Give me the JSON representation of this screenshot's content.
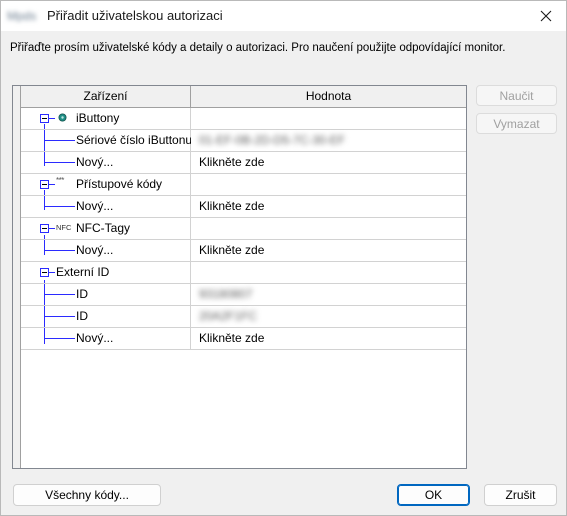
{
  "window": {
    "app_name": "Mpds",
    "title": "Přiřadit uživatelskou autorizaci"
  },
  "instruction": "Přiřaďte prosím uživatelské kódy a detaily o autorizaci. Pro naučení použijte odpovídající monitor.",
  "grid": {
    "columns": [
      "Zařízení",
      "Hodnota"
    ],
    "groups": {
      "ibuttony": {
        "label": "iButtony",
        "icon": "ibutton-icon",
        "serial_label": "Sériové číslo iButtonu",
        "serial_value": "01-EF-0B-2D-D5-7C-30-EF",
        "new_label": "Nový...",
        "new_value": "Klikněte zde"
      },
      "pristupove_kody": {
        "label": "Přístupové kódy",
        "icon": "keypad-icon",
        "icon_text": "***",
        "new_label": "Nový...",
        "new_value": "Klikněte zde"
      },
      "nfc_tagy": {
        "label": "NFC-Tagy",
        "icon": "nfc-icon",
        "icon_text": "NFC",
        "new_label": "Nový...",
        "new_value": "Klikněte zde"
      },
      "externi_id": {
        "label": "Externí ID",
        "items": [
          {
            "label": "ID",
            "value": "93180807"
          },
          {
            "label": "ID",
            "value": "20A2F1FC"
          }
        ],
        "new_label": "Nový...",
        "new_value": "Klikněte zde"
      }
    }
  },
  "buttons": {
    "learn": "Naučit",
    "delete": "Vymazat",
    "all_codes": "Všechny kódy...",
    "ok": "OK",
    "cancel": "Zrušit"
  },
  "colors": {
    "tree_lines": "#2b2bff",
    "default_button_border": "#0067c0",
    "ibutton_icon": "#1f8f86"
  }
}
